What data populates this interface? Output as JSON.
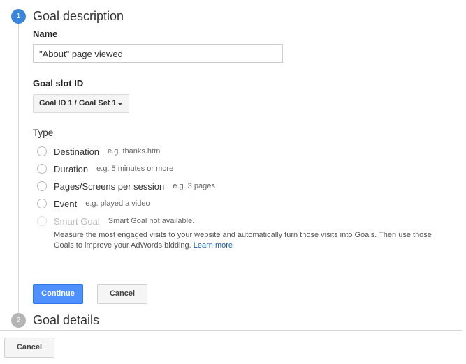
{
  "steps": [
    {
      "number": "1",
      "title": "Goal description",
      "state": "active"
    },
    {
      "number": "2",
      "title": "Goal details",
      "state": "inactive"
    }
  ],
  "form": {
    "name_label": "Name",
    "name_value": "\"About\" page viewed",
    "slot_label": "Goal slot ID",
    "slot_value": "Goal ID 1 / Goal Set 1",
    "type_label": "Type"
  },
  "type_options": [
    {
      "label": "Destination",
      "hint": "e.g. thanks.html",
      "enabled": true,
      "selected": false
    },
    {
      "label": "Duration",
      "hint": "e.g. 5 minutes or more",
      "enabled": true,
      "selected": false
    },
    {
      "label": "Pages/Screens per session",
      "hint": "e.g. 3 pages",
      "enabled": true,
      "selected": false
    },
    {
      "label": "Event",
      "hint": "e.g. played a video",
      "enabled": true,
      "selected": false
    },
    {
      "label": "Smart Goal",
      "hint": "Smart Goal not available.",
      "enabled": false,
      "selected": false
    }
  ],
  "smart_goal": {
    "description": "Measure the most engaged visits to your website and automatically turn those visits into Goals. Then use those Goals to improve your AdWords bidding.",
    "link_text": "Learn more"
  },
  "buttons": {
    "continue": "Continue",
    "cancel": "Cancel",
    "footer_cancel": "Cancel"
  },
  "colors": {
    "accent": "#4d90fe",
    "step_active": "#3a85d8",
    "step_inactive": "#b5b5b5",
    "link": "#1f5fa8"
  }
}
